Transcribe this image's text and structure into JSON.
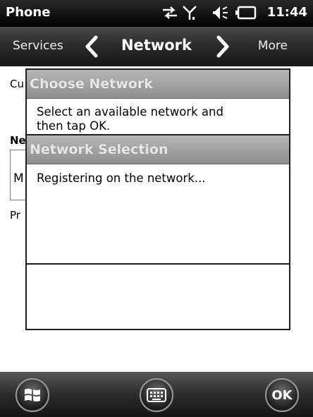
{
  "statusbar": {
    "app_title": "Phone",
    "time": "11:44"
  },
  "navbar": {
    "left_label": "Services",
    "title": "Network",
    "right_label": "More"
  },
  "background": {
    "line1": "Cu",
    "line2": "Ne",
    "box_text": "M",
    "line3": "Pr"
  },
  "dialog_choose": {
    "title": "Choose Network",
    "message_line1": "Select an available network and",
    "message_line2": "then tap OK."
  },
  "dialog_selection": {
    "title": "Network Selection",
    "message": "Registering on the network..."
  },
  "bottombar": {
    "ok_label": "OK"
  },
  "icons": [
    "data-arrows-icon",
    "signal-icon",
    "speaker-icon",
    "battery-icon",
    "chevron-left-icon",
    "chevron-right-icon",
    "windows-start-icon",
    "keyboard-icon"
  ]
}
